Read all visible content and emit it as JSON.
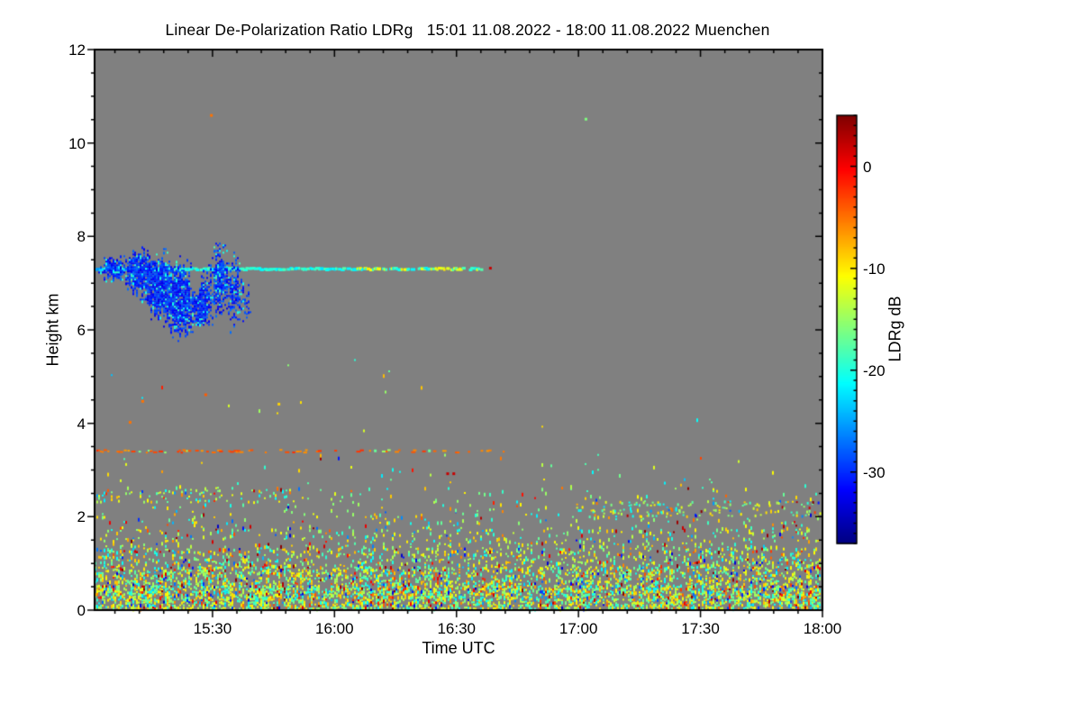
{
  "title": "Linear De-Polarization Ratio LDRg   15:01 11.08.2022 - 18:00 11.08.2022 Muenchen",
  "chart_data": {
    "type": "heatmap",
    "title": "Linear De-Polarization Ratio LDRg   15:01 11.08.2022 - 18:00 11.08.2022 Muenchen",
    "station": "Muenchen",
    "time_start": "15:01",
    "time_end": "18:00",
    "date": "11.08.2022",
    "duration_min": 179,
    "xlabel": "Time UTC",
    "ylabel": "Height km",
    "y_range_km": [
      0,
      12
    ],
    "y_ticks": [
      0,
      2,
      4,
      6,
      8,
      10,
      12
    ],
    "y_minor_step_km": 0.5,
    "x_ticks": [
      {
        "label": "15:30",
        "t": 29
      },
      {
        "label": "16:00",
        "t": 59
      },
      {
        "label": "16:30",
        "t": 89
      },
      {
        "label": "17:00",
        "t": 119
      },
      {
        "label": "17:30",
        "t": 149
      },
      {
        "label": "18:00",
        "t": 179
      }
    ],
    "x_minor_step_min": 6,
    "background_color": "#808080",
    "frame_color": "#000000",
    "colorbar": {
      "label": "LDRg dB",
      "ticks": [
        0,
        -10,
        -20,
        -30
      ],
      "range_db": [
        -37,
        5
      ],
      "colormap": "jet",
      "minor_tick_step_db": 1
    },
    "features": {
      "surface_noise_layers": [
        {
          "h0": 0.05,
          "h1": 0.55,
          "density": 0.6
        },
        {
          "h0": 0.55,
          "h1": 0.95,
          "density": 0.42
        },
        {
          "h0": 0.95,
          "h1": 1.35,
          "density": 0.26
        },
        {
          "h0": 1.35,
          "h1": 1.75,
          "density": 0.13
        },
        {
          "h0": 1.75,
          "h1": 2.15,
          "density": 0.06
        },
        {
          "h0": 2.15,
          "h1": 2.65,
          "density": 0.028
        },
        {
          "h0": 2.65,
          "h1": 3.35,
          "density": 0.011
        },
        {
          "h0": 3.35,
          "h1": 5.4,
          "density": 0.0012
        }
      ],
      "noise_value_mix_db": [
        {
          "v0": -14,
          "v1": -8,
          "w": 0.37
        },
        {
          "v0": -18,
          "v1": -14,
          "w": 0.25
        },
        {
          "v0": -22,
          "v1": -18,
          "w": 0.19
        },
        {
          "v0": -8,
          "v1": -1,
          "w": 0.08
        },
        {
          "v0": -1,
          "v1": 5,
          "w": 0.04
        },
        {
          "v0": -34,
          "v1": -23,
          "w": 0.07
        }
      ],
      "speckle_bands": [
        {
          "t0": 0,
          "t1": 52,
          "h0": 2.35,
          "h1": 2.6,
          "density": 0.16
        },
        {
          "t0": 118,
          "t1": 179,
          "h0": 2.05,
          "h1": 2.35,
          "density": 0.14
        }
      ],
      "melting_layer_line": {
        "height_km": 7.33,
        "t0": 0,
        "t1": 95,
        "dash_probability": 0.72,
        "value_db_main": -20,
        "value_db_yellow_section": -11,
        "yellow_section_t": [
          64,
          95
        ],
        "end_dot": {
          "t": 97,
          "value_db": 2
        }
      },
      "aerosol_dotted_line": {
        "height_km": 3.42,
        "t0": 0,
        "t1": 102,
        "value_db": -4,
        "density_start": 0.5,
        "density_end": 0.06
      },
      "cloud": {
        "description": "dense blue cloud layer, LDRg ~ -33 to -26 dB",
        "value_db_range": [
          -33,
          -27
        ],
        "cyan_speckle_db_range": [
          -22,
          -18
        ],
        "blobs": [
          {
            "t": 5,
            "h": 7.3,
            "rx": 4.5,
            "ry": 0.3,
            "a": 0.75
          },
          {
            "t": 11,
            "h": 7.25,
            "rx": 4.5,
            "ry": 0.5,
            "a": 0.92
          },
          {
            "t": 16,
            "h": 6.95,
            "rx": 5.0,
            "ry": 0.72,
            "a": 0.96
          },
          {
            "t": 21,
            "h": 6.7,
            "rx": 5.0,
            "ry": 0.78,
            "a": 0.97
          },
          {
            "t": 26,
            "h": 6.6,
            "rx": 3.0,
            "ry": 0.65,
            "a": 0.92
          },
          {
            "t": 30.5,
            "h": 7.05,
            "rx": 3.0,
            "ry": 0.85,
            "a": 0.7
          },
          {
            "t": 34,
            "h": 6.85,
            "rx": 2.6,
            "ry": 0.95,
            "a": 0.55
          },
          {
            "t": 37,
            "h": 6.7,
            "rx": 1.8,
            "ry": 0.6,
            "a": 0.45
          }
        ],
        "notch": {
          "t": 24.6,
          "h": 7.08,
          "rx": 1.6,
          "ry": 0.35
        }
      },
      "isolated_dots": [
        {
          "t": 28.4,
          "h": 10.6,
          "v": -5
        },
        {
          "t": 120.5,
          "h": 10.52,
          "v": -16
        },
        {
          "t": 11.5,
          "h": 4.48,
          "v": -5
        },
        {
          "t": 8.4,
          "h": 4.03,
          "v": -5
        },
        {
          "t": 27,
          "h": 4.62,
          "v": -4
        },
        {
          "t": 45,
          "h": 4.42,
          "v": -9
        },
        {
          "t": 68.7,
          "h": 3.42,
          "v": -17
        },
        {
          "t": 82,
          "h": 3.42,
          "v": -17
        },
        {
          "t": 86.5,
          "h": 2.93,
          "v": 2
        },
        {
          "t": 88,
          "h": 2.93,
          "v": 2
        }
      ]
    }
  }
}
